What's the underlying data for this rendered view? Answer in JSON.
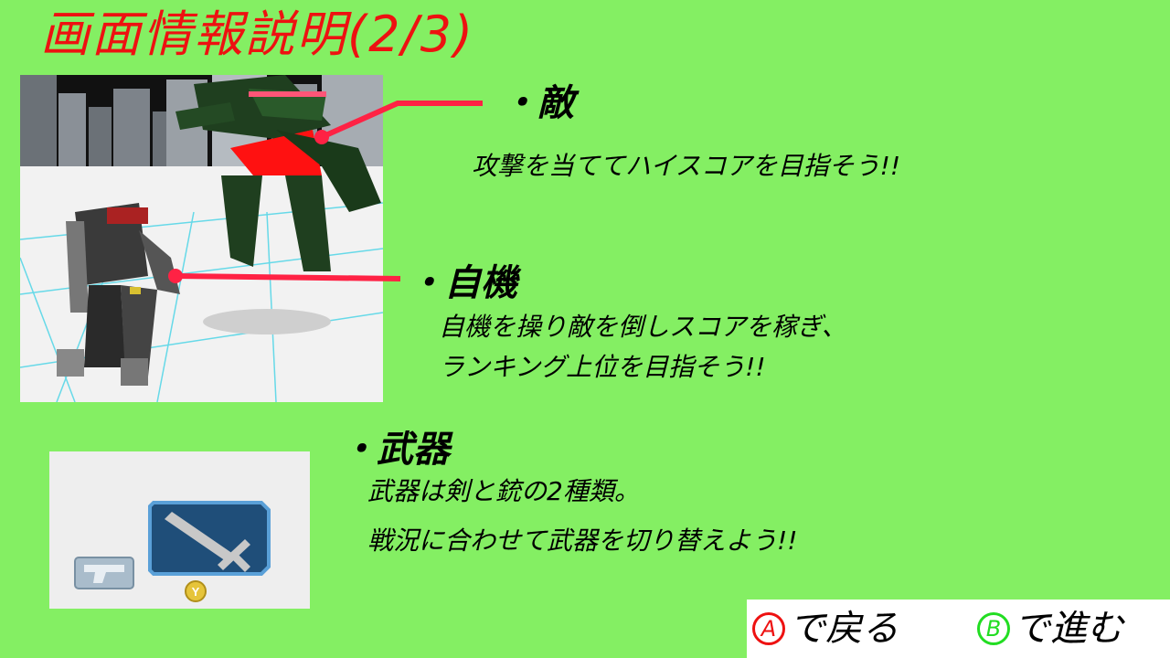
{
  "title": "画面情報説明(2/3)",
  "sections": {
    "enemy": {
      "heading": "・敵",
      "lines": [
        "攻撃を当ててハイスコアを目指そう!!"
      ]
    },
    "player": {
      "heading": "・自機",
      "lines": [
        "自機を操り敵を倒しスコアを稼ぎ、",
        "ランキング上位を目指そう!!"
      ]
    },
    "weapon": {
      "heading": "・武器",
      "lines": [
        "武器は剣と銃の2種類。",
        "戦況に合わせて武器を切り替えよう!!"
      ]
    }
  },
  "weapon_panel": {
    "selected_weapon_icon": "sword-icon",
    "other_weapon_icon": "gun-icon",
    "switch_button_label": "Y"
  },
  "nav": {
    "back": {
      "button_letter": "A",
      "label": "で戻る",
      "color": "#ee1111"
    },
    "forward": {
      "button_letter": "B",
      "label": "で進む",
      "color": "#22dd22"
    }
  },
  "colors": {
    "background": "#84ef63",
    "title": "#ee1111",
    "pointer": "#ff2244",
    "weapon_frame": "#1f4e79"
  }
}
